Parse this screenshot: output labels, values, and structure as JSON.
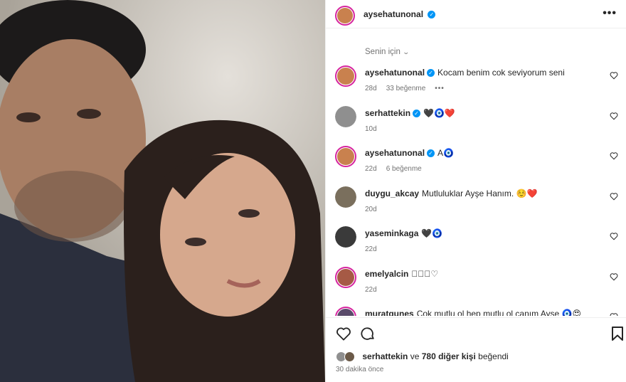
{
  "post": {
    "author": "aysehatunonal",
    "more_icon": "more-horizontal-icon"
  },
  "sort": {
    "label": "Senin için"
  },
  "comments": [
    {
      "user": "aysehatunonal",
      "verified": true,
      "text": "Kocam benim cok seviyorum seni",
      "age": "28d",
      "likes": "33 beğenme",
      "more": "•••",
      "avatar_color": "#c9814e"
    },
    {
      "user": "serhattekin",
      "verified": true,
      "text": "🖤🧿❤️",
      "age": "10d",
      "likes": "",
      "more": "",
      "avatar_color": "#8f8f8f"
    },
    {
      "user": "aysehatunonal",
      "verified": true,
      "text": "A🧿",
      "age": "22d",
      "likes": "6 beğenme",
      "more": "",
      "avatar_color": "#c9814e"
    },
    {
      "user": "duygu_akcay",
      "verified": false,
      "text": "Mutluluklar Ayşe Hanım. ☺️❤️",
      "age": "20d",
      "likes": "",
      "more": "",
      "avatar_color": "#7a6f5d"
    },
    {
      "user": "yaseminkaga",
      "verified": false,
      "text": "🖤🧿",
      "age": "22d",
      "likes": "",
      "more": "",
      "avatar_color": "#3a3a3a"
    },
    {
      "user": "emelyalcin",
      "verified": false,
      "text": "♡🏽🏽♡",
      "age": "22d",
      "likes": "",
      "more": "",
      "avatar_color": "#a65a45"
    },
    {
      "user": "muratgunes",
      "verified": false,
      "text": "Cok mutlu ol hep mutlu ol canım Ayşe 🧿😍",
      "age": "",
      "likes": "",
      "more": "",
      "avatar_color": "#5a4a6a"
    }
  ],
  "actions": {
    "like_icon": "heart-icon",
    "comment_icon": "comment-icon",
    "save_icon": "bookmark-icon"
  },
  "likes": {
    "user": "serhattekin",
    "connector": "ve",
    "others": "780 diğer kişi",
    "suffix": "beğendi"
  },
  "timestamp": "30 dakika önce",
  "colors": {
    "verified": "#0095f6",
    "heart": "#ed4956",
    "story_ring": "#d6249f",
    "muted_text": "#737373"
  }
}
